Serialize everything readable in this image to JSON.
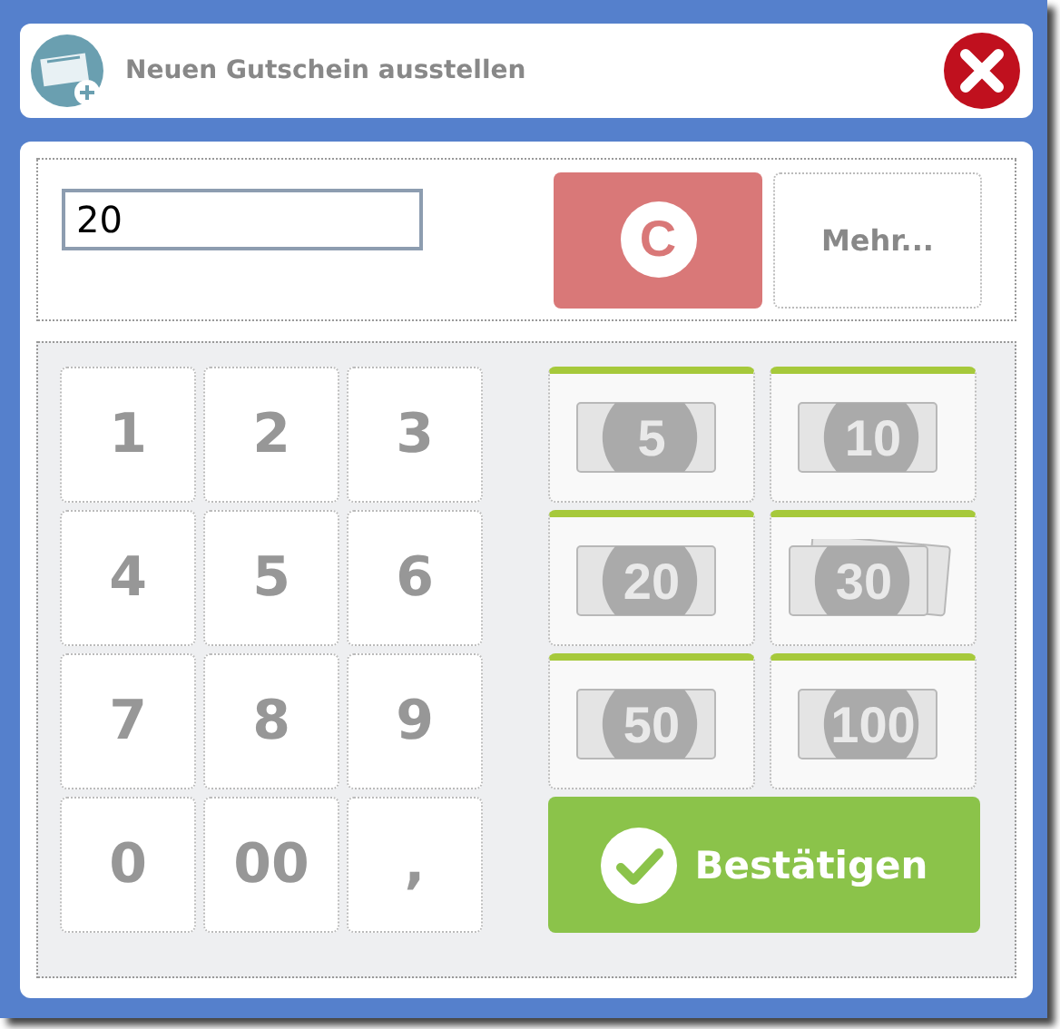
{
  "dialog": {
    "title": "Neuen Gutschein ausstellen"
  },
  "amount": {
    "value": "20"
  },
  "clear_button": "C",
  "more_button": "Mehr...",
  "keypad": [
    "1",
    "2",
    "3",
    "4",
    "5",
    "6",
    "7",
    "8",
    "9",
    "0",
    "00",
    ","
  ],
  "notes": [
    {
      "label": "5",
      "kind": "single"
    },
    {
      "label": "10",
      "kind": "single"
    },
    {
      "label": "20",
      "kind": "single"
    },
    {
      "label": "30",
      "kind": "stack"
    },
    {
      "label": "50",
      "kind": "single"
    },
    {
      "label": "100",
      "kind": "single"
    }
  ],
  "confirm_button": "Bestätigen"
}
